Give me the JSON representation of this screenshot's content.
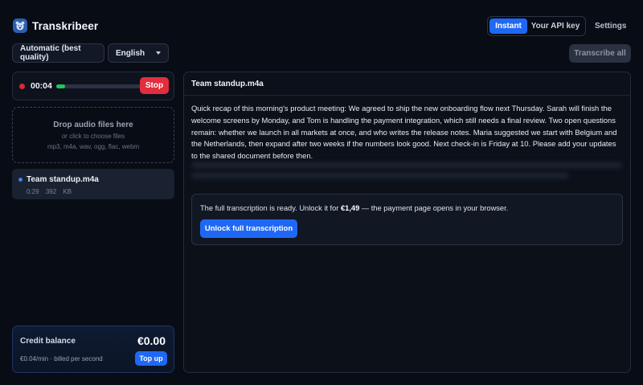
{
  "app": {
    "name": "Transkribeer",
    "logo_icon": "bear-logo-icon"
  },
  "header": {
    "mode_tabs": [
      {
        "label": "Instant",
        "active": true
      },
      {
        "label": "Your API key",
        "active": false
      }
    ],
    "settings_label": "Settings"
  },
  "controls": {
    "quality_value": "Automatic (best quality)",
    "language_value": "English",
    "transcribe_all_label": "Transcribe all",
    "transcribe_all_disabled": true
  },
  "recorder": {
    "time": "00:04",
    "level_fraction": 0.1,
    "stop_label": "Stop",
    "status_color": "#d8283a"
  },
  "dropzone": {
    "title": "Drop audio files here",
    "subtitle": "or click to choose files",
    "formats": "mp3, m4a, wav, ogg, flac, webm"
  },
  "files": [
    {
      "name": "Team standup.m4a",
      "duration": "0:29",
      "size": "392 KB",
      "selected": true
    }
  ],
  "credit": {
    "label": "Credit balance",
    "amount": "€0.00",
    "rate": "€0.04/min · billed per second",
    "topup_label": "Top up"
  },
  "main": {
    "title": "Team standup.m4a",
    "transcript": "Quick recap of this morning's product meeting: We agreed to ship the new onboarding flow next Thursday. Sarah will finish the welcome screens by Monday, and Tom is handling the payment integration, which still needs a final review. Two open questions remain: whether we launch in all markets at once, and who writes the release notes. Maria suggested we start with Belgium and the Netherlands, then expand after two weeks if the numbers look good. Next check-in is Friday at 10. Please add your updates to the shared document before then.",
    "unlock": {
      "text_before": "The full transcription is ready. Unlock it for ",
      "price": "€1,49",
      "text_after": " — the payment page opens in your browser.",
      "button_label": "Unlock full transcription"
    }
  },
  "colors": {
    "accent": "#1f68f5",
    "danger": "#e32d3d",
    "level": "#22c55e",
    "background": "#080c14"
  }
}
